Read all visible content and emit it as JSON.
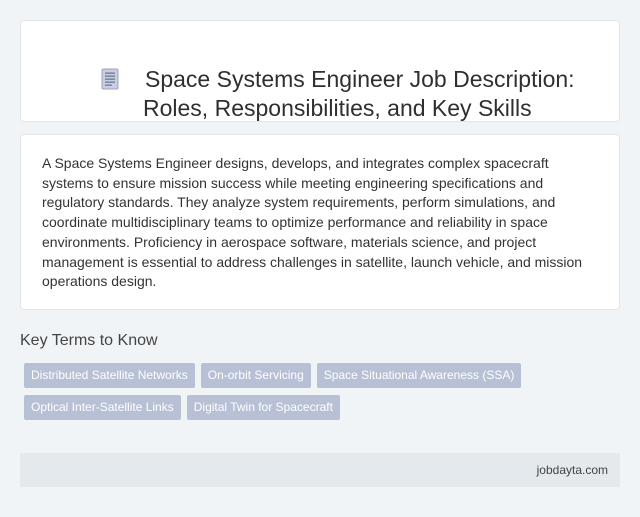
{
  "header": {
    "icon": "document-icon",
    "title": "Space Systems Engineer Job Description: Roles, Responsibilities, and Key Skills"
  },
  "description": {
    "text": "A Space Systems Engineer designs, develops, and integrates complex spacecraft systems to ensure mission success while meeting engineering specifications and regulatory standards. They analyze system requirements, perform simulations, and coordinate multidisciplinary teams to optimize performance and reliability in space environments. Proficiency in aerospace software, materials science, and project management is essential to address challenges in satellite, launch vehicle, and mission operations design."
  },
  "key_terms": {
    "heading": "Key Terms to Know",
    "tags": [
      "Distributed Satellite Networks",
      "On-orbit Servicing",
      "Space Situational Awareness (SSA)",
      "Optical Inter-Satellite Links",
      "Digital Twin for Spacecraft"
    ]
  },
  "footer": {
    "site": "jobdayta.com"
  },
  "colors": {
    "background": "#f0f4f7",
    "card": "#ffffff",
    "tag": "#b8c0d6",
    "footer": "#e3e9ec"
  }
}
